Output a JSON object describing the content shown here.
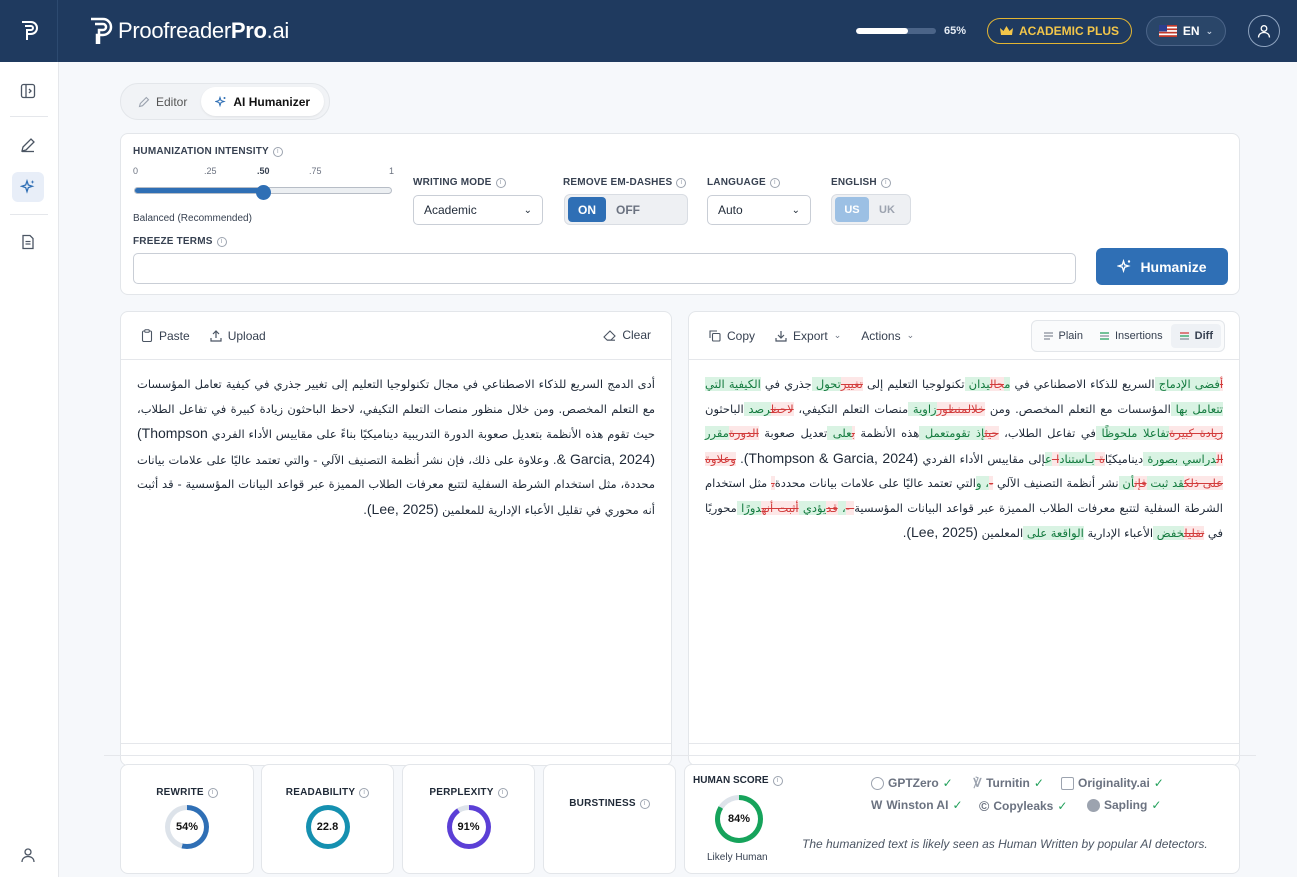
{
  "header": {
    "brand_prefix": "Proofreader",
    "brand_bold": "Pro",
    "brand_suffix": ".ai",
    "usage_percent": 65,
    "usage_label": "65%",
    "plan_label": "ACADEMIC PLUS",
    "language_label": "EN"
  },
  "mode_tabs": [
    {
      "label": "Editor",
      "active": false
    },
    {
      "label": "AI Humanizer",
      "active": true
    }
  ],
  "settings": {
    "intensity_label": "HUMANIZATION INTENSITY",
    "ticks": [
      "0",
      ".25",
      ".50",
      ".75",
      "1"
    ],
    "intensity_value": 0.5,
    "intensity_note": "Balanced (Recommended)",
    "writing_mode_label": "WRITING MODE",
    "writing_mode_value": "Academic",
    "em_dash_label": "REMOVE EM-DASHES",
    "em_dash_on": "ON",
    "em_dash_off": "OFF",
    "language_label": "LANGUAGE",
    "language_value": "Auto",
    "english_label": "ENGLISH",
    "english_us": "US",
    "english_uk": "UK",
    "freeze_label": "FREEZE TERMS",
    "freeze_value": "",
    "humanize_label": "Humanize"
  },
  "input_panel": {
    "paste_label": "Paste",
    "upload_label": "Upload",
    "clear_label": "Clear",
    "text_parts": [
      "أدى الدمج السريع للذكاء الاصطناعي في مجال تكنولوجيا التعليم إلى تغيير جذري في كيفية تعامل المؤسسات مع التعلم المخصص. ومن خلال منظور منصات التعلم التكيفي، لاحظ الباحثون زيادة كبيرة في تفاعل الطلاب، حيث تقوم هذه الأنظمة بتعديل صعوبة الدورة التدريبية ديناميكيًا بناءً على مقاييس الأداء الفردي ",
      "(Thompson & Garcia, 2024)",
      ". وعلاوة على ذلك، فإن نشر أنظمة التصنيف الآلي - والتي تعتمد عاليًا على علامات بيانات محددة، مثل استخدام الشرطة السفلية لتتبع معرفات الطلاب المميزة عبر قواعد البيانات المؤسسية - قد أثبت أنه محوري في تقليل الأعباء الإدارية للمعلمين ",
      "(Lee, 2025)",
      "."
    ]
  },
  "output_panel": {
    "copy_label": "Copy",
    "export_label": "Export",
    "actions_label": "Actions",
    "views": [
      {
        "label": "Plain",
        "active": false
      },
      {
        "label": "Insertions",
        "active": false
      },
      {
        "label": "Diff",
        "active": true
      }
    ],
    "diff_segments": [
      {
        "t": "أ",
        "k": "del"
      },
      {
        "t": "فضى ",
        "k": "ins"
      },
      {
        "t": "الإ",
        "k": "ins"
      },
      {
        "t": "دماج ",
        "k": "ins"
      },
      {
        "t": "السريع للذكاء الاصطناعي في ",
        "k": ""
      },
      {
        "t": "م",
        "k": "ins"
      },
      {
        "t": "جال",
        "k": "del"
      },
      {
        "t": "يدان ",
        "k": "ins"
      },
      {
        "t": "تكنولوجيا التعليم إلى ",
        "k": ""
      },
      {
        "t": "تغيير",
        "k": "del"
      },
      {
        "t": "تحول ",
        "k": "ins"
      },
      {
        "t": "جذري في ",
        "k": ""
      },
      {
        "t": "الكيفية التي ",
        "k": "ins"
      },
      {
        "t": "تتعامل ",
        "k": "ins"
      },
      {
        "t": "بها ",
        "k": "ins"
      },
      {
        "t": "المؤسسات مع التعلم المخصص. ومن ",
        "k": ""
      },
      {
        "t": "خلال",
        "k": "del"
      },
      {
        "t": "منظور",
        "k": "del"
      },
      {
        "t": "زاوية ",
        "k": "ins"
      },
      {
        "t": "منصات التعلم التكيفي، ",
        "k": ""
      },
      {
        "t": "لاحظ",
        "k": "del"
      },
      {
        "t": "رصد ",
        "k": "ins"
      },
      {
        "t": "الباحثون ",
        "k": ""
      },
      {
        "t": "زيادة كبيرة",
        "k": "del"
      },
      {
        "t": "تفاعلا ملحوظًا ",
        "k": "ins"
      },
      {
        "t": "في تفاعل الطلاب، ",
        "k": ""
      },
      {
        "t": "حيث",
        "k": "del"
      },
      {
        "t": "إذ تقوم",
        "k": "ins"
      },
      {
        "t": "تعمل ",
        "k": "ins"
      },
      {
        "t": "هذه الأنظمة ",
        "k": ""
      },
      {
        "t": "ب",
        "k": "del"
      },
      {
        "t": "على ",
        "k": "ins"
      },
      {
        "t": "تعديل صعوبة ",
        "k": ""
      },
      {
        "t": "الدورة",
        "k": "del"
      },
      {
        "t": "مقرر ",
        "k": "ins"
      },
      {
        "t": "ال",
        "k": "del"
      },
      {
        "t": "دراسي ",
        "k": "ins"
      },
      {
        "t": "ب",
        "k": "ins"
      },
      {
        "t": "صورة ",
        "k": "ins"
      },
      {
        "t": "ديناميكيًا",
        "k": ""
      },
      {
        "t": "ة ",
        "k": "del"
      },
      {
        "t": "بـاستناد",
        "k": "ins"
      },
      {
        "t": "ا ",
        "k": "del"
      },
      {
        "t": "ع",
        "k": "ins"
      },
      {
        "t": "إلى ",
        "k": ""
      },
      {
        "t": "مقاييس الأداء الفردي ",
        "k": ""
      },
      {
        "t": "(Thompson & Garcia, 2024)",
        "k": "ltr"
      },
      {
        "t": ". ",
        "k": ""
      },
      {
        "t": "وعلاوة على ذلك",
        "k": "del"
      },
      {
        "t": "قد ثبت ",
        "k": "ins"
      },
      {
        "t": "فإن",
        "k": "del"
      },
      {
        "t": "أن ",
        "k": "ins"
      },
      {
        "t": "نشر أنظمة التصنيف الآلي ",
        "k": ""
      },
      {
        "t": "-",
        "k": "del"
      },
      {
        "t": "، ",
        "k": "ins"
      },
      {
        "t": "و",
        "k": "ins"
      },
      {
        "t": "التي تعتمد عاليًا على علامات بيانات محددة",
        "k": ""
      },
      {
        "t": "،",
        "k": "del"
      },
      {
        "t": " مثل استخدام الشرطة السفلية لتتبع معرفات الطلاب المميزة عبر قواعد البيانات المؤسسية",
        "k": ""
      },
      {
        "t": " -",
        "k": "del"
      },
      {
        "t": "، ",
        "k": "ins"
      },
      {
        "t": "قد",
        "k": "del"
      },
      {
        "t": "يؤدي ",
        "k": "ins"
      },
      {
        "t": "أثبت أنه",
        "k": "del"
      },
      {
        "t": "دورًا ",
        "k": "ins"
      },
      {
        "t": "محوريًا ",
        "k": ""
      },
      {
        "t": "في ",
        "k": ""
      },
      {
        "t": "تقليل",
        "k": "del"
      },
      {
        "t": "خفض ",
        "k": "ins"
      },
      {
        "t": "الأعباء الإدارية ",
        "k": ""
      },
      {
        "t": "الواقعة على ",
        "k": "ins"
      },
      {
        "t": "المعلمين ",
        "k": ""
      },
      {
        "t": "(Lee, 2025)",
        "k": "ltr"
      },
      {
        "t": ".",
        "k": ""
      }
    ]
  },
  "metrics": [
    {
      "label": "REWRITE",
      "display": "54%",
      "percent": 54,
      "color": "#2f6fb5"
    },
    {
      "label": "READABILITY",
      "display": "22.8",
      "percent": 100,
      "color": "#1590b0"
    },
    {
      "label": "PERPLEXITY",
      "display": "91%",
      "percent": 91,
      "color": "#5b3fd6"
    },
    {
      "label": "BURSTINESS",
      "display": "",
      "percent": 0,
      "color": "#cccccc"
    }
  ],
  "human_score": {
    "label": "HUMAN SCORE",
    "display": "84%",
    "percent": 84,
    "color": "#16a35b",
    "caption": "Likely Human",
    "detectors": [
      "GPTZero",
      "Turnitin",
      "Originality.ai",
      "Winston AI",
      "Copyleaks",
      "Sapling"
    ],
    "note": "The humanized text is likely seen as Human Written by popular AI detectors."
  }
}
